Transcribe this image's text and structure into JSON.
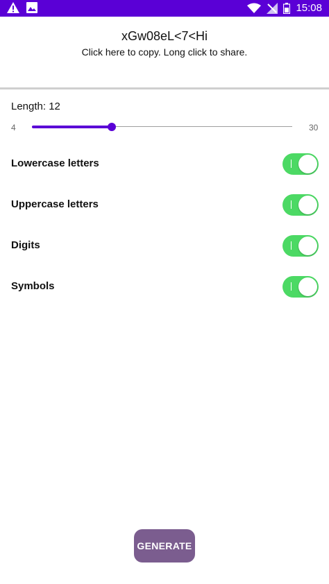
{
  "status_bar": {
    "time": "15:08",
    "left_icons": [
      "warning-icon",
      "image-icon"
    ],
    "right_icons": [
      "wifi-icon",
      "no-signal-icon",
      "battery-icon"
    ],
    "color": "#5a00d6"
  },
  "password": {
    "value": "xGw08eL<7<Hi",
    "hint": "Click here to copy. Long click to share."
  },
  "length": {
    "label": "Length: 12",
    "min_label": "4",
    "max_label": "30",
    "min": 4,
    "max": 30,
    "value": 12
  },
  "options": [
    {
      "label": "Lowercase letters",
      "enabled": true
    },
    {
      "label": "Uppercase letters",
      "enabled": true
    },
    {
      "label": "Digits",
      "enabled": true
    },
    {
      "label": "Symbols",
      "enabled": true
    }
  ],
  "generate_button": {
    "label": "GENERATE",
    "color": "#7b5d8f"
  },
  "colors": {
    "accent": "#5a00d6",
    "toggle_on": "#4cd964"
  }
}
